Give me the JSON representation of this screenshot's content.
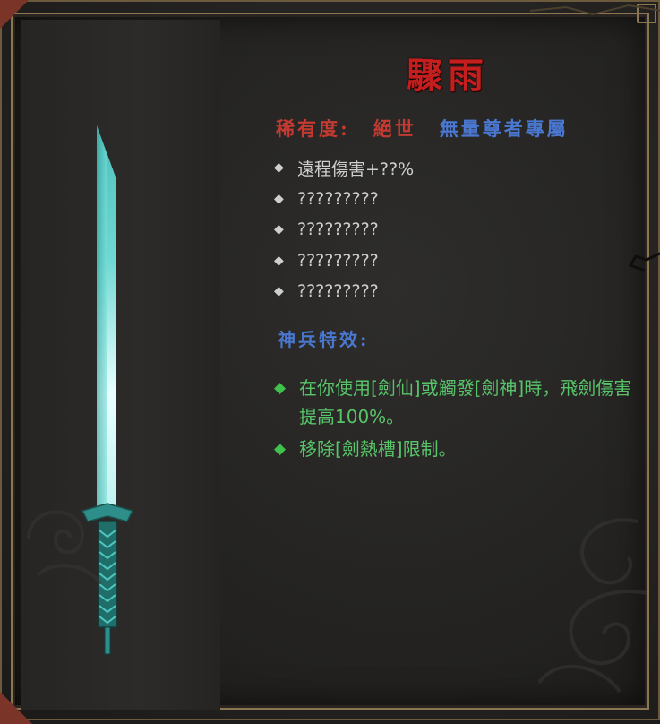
{
  "item": {
    "name": "驟雨",
    "rarity_label": "稀有度:",
    "rarity_value": "絕世",
    "exclusive": "無量尊者專屬",
    "stats": [
      "遠程傷害+??%",
      "?????????",
      "?????????",
      "?????????",
      "?????????"
    ],
    "effect_title": "神兵特效:",
    "effects": [
      "在你使用[劍仙]或觸發[劍神]時，飛劍傷害提高100%。",
      "移除[劍熱槽]限制。"
    ]
  },
  "icons": {
    "weapon": "sword-icon",
    "stat_bullet": "diamond-icon",
    "effect_bullet": "green-diamond-icon"
  },
  "colors": {
    "title": "#c41e1e",
    "rarity": "#c43a32",
    "exclusive": "#4a78d0",
    "stat_text": "#cfcfcf",
    "effect_text": "#58c46a",
    "blade": "#5fd6cf",
    "frame": "#8a7650"
  }
}
